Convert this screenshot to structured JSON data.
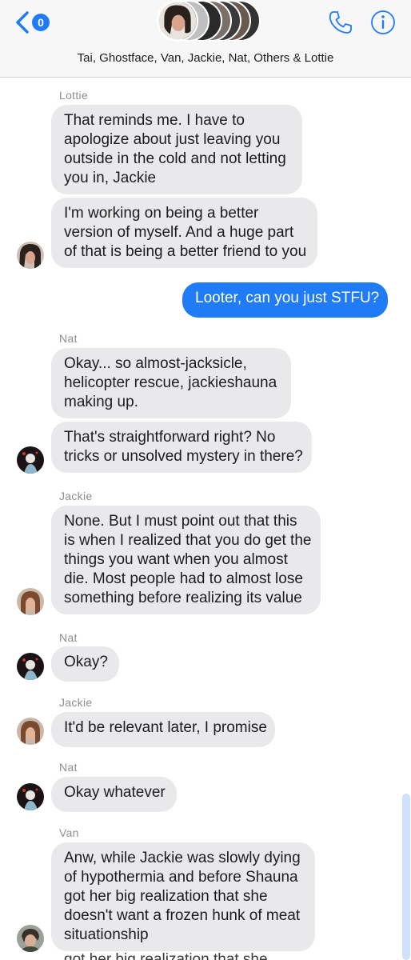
{
  "header": {
    "back_badge": "0",
    "title": "Tai, Ghostface, Van, Jackie, Nat, Others & Lottie",
    "colors": {
      "bar_bg": "#f7f7f8",
      "accent": "#1f7cf6"
    }
  },
  "messages": [
    {
      "sender": "Lottie",
      "direction": "in",
      "lines": [
        "That reminds me. I have to",
        "apologize about just leaving you",
        "outside in the cold and not letting",
        "you in, Jackie"
      ]
    },
    {
      "direction": "in",
      "lines": [
        "I'm working on being a better",
        "version of myself. And a huge part",
        "of that is being a better friend to you"
      ],
      "avatar": "lottie-avatar"
    },
    {
      "direction": "out",
      "lines": [
        "Looter, can you just STFU?"
      ]
    },
    {
      "sender": "Nat",
      "direction": "in",
      "lines": [
        "Okay... so almost-jacksicle,",
        "helicopter rescue, jackieshauna",
        "making up."
      ]
    },
    {
      "direction": "in",
      "lines": [
        "That's straightforward right? No",
        "tricks or unsolved mystery in there?"
      ],
      "avatar": "nat-avatar"
    },
    {
      "sender": "Jackie",
      "direction": "in",
      "lines": [
        "None. But I must point out that this",
        "is when I realized that you do get the",
        "things you want when you almost",
        "die. Most people had to almost lose",
        "something before realizing its value"
      ],
      "avatar": "jackie-avatar"
    },
    {
      "sender": "Nat",
      "direction": "in",
      "lines": [
        "Okay?"
      ],
      "avatar": "nat-avatar"
    },
    {
      "sender": "Jackie",
      "direction": "in",
      "lines": [
        "It'd be relevant later, I promise"
      ],
      "avatar": "jackie-avatar"
    },
    {
      "sender": "Nat",
      "direction": "in",
      "lines": [
        "Okay whatever"
      ],
      "avatar": "nat-avatar"
    },
    {
      "sender": "Van",
      "direction": "in",
      "lines": [
        "Anw, while Jackie was slowly dying",
        "of hypothermia and before Shauna",
        "got her big realization that she",
        "doesn't want a frozen hunk of meat",
        "situationship"
      ],
      "avatar": "van-avatar"
    }
  ],
  "partial_text": "got her big realization that she",
  "bubble_colors": {
    "incoming": "#e9e9eb",
    "outgoing": "#1f7cf6"
  }
}
